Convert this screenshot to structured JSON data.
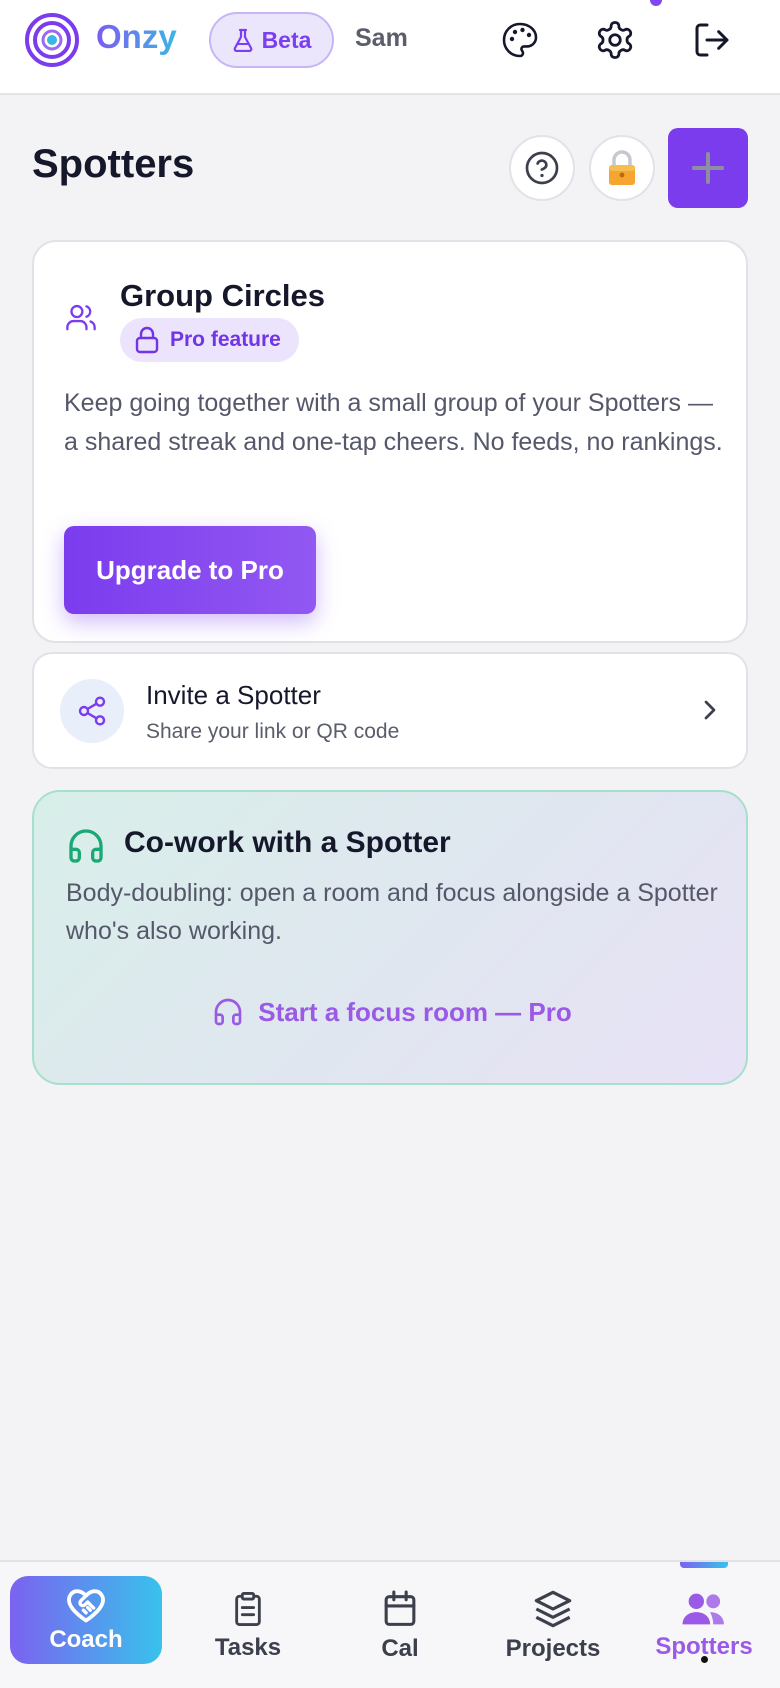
{
  "header": {
    "brand": "Onzy",
    "beta_label": "Beta",
    "user_name": "Sam",
    "icons": [
      "palette-icon",
      "gear-icon",
      "logout-icon"
    ]
  },
  "page": {
    "title": "Spotters"
  },
  "group_circles": {
    "title": "Group Circles",
    "badge": "Pro feature",
    "description": "Keep going together with a small group of your Spotters — a shared streak and one-tap cheers. No feeds, no rankings.",
    "cta": "Upgrade to Pro"
  },
  "invite": {
    "title": "Invite a Spotter",
    "subtitle": "Share your link or QR code"
  },
  "cowork": {
    "title": "Co-work with a Spotter",
    "description": "Body-doubling: open a room and focus alongside a Spotter who's also working.",
    "cta": "Start a focus room — Pro"
  },
  "nav": {
    "active": "Spotters",
    "items": [
      {
        "label": "Coach",
        "icon": "heart-handshake-icon"
      },
      {
        "label": "Tasks",
        "icon": "clipboard-icon"
      },
      {
        "label": "Cal",
        "icon": "calendar-icon"
      },
      {
        "label": "Projects",
        "icon": "layers-icon"
      },
      {
        "label": "Spotters",
        "icon": "users-icon"
      }
    ]
  },
  "colors": {
    "accent": "#7b3cee",
    "brand_gradient_start": "#7b62f0",
    "brand_gradient_end": "#38c2ec",
    "cowork_accent": "#18a974",
    "background": "#f3f3f6"
  }
}
